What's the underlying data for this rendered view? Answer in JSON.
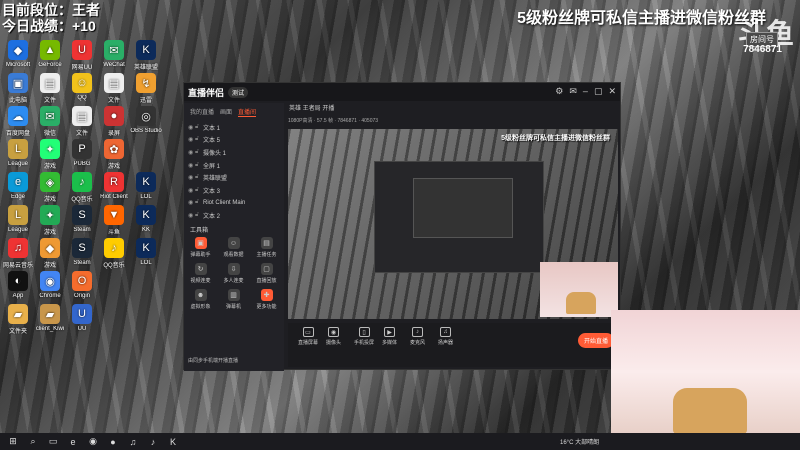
{
  "overlay": {
    "rank": "目前段位：王者",
    "today": "今日战绩：+10",
    "banner": "5级粉丝牌可私信主播进微信粉丝群",
    "room_label": "房间号",
    "room_id": "7846871"
  },
  "desktop_icons": [
    {
      "label": "Microsoft",
      "color": "#1d6fe0",
      "glyph": "◆"
    },
    {
      "label": "GeForce",
      "color": "#76b900",
      "glyph": "▲"
    },
    {
      "label": "网易UU",
      "color": "#e33",
      "glyph": "U"
    },
    {
      "label": "WeChat",
      "color": "#2aae67",
      "glyph": "✉"
    },
    {
      "label": "英雄联盟",
      "color": "#0c2a5a",
      "glyph": "K"
    },
    {
      "label": "此电脑",
      "color": "#3a7bd5",
      "glyph": "▣"
    },
    {
      "label": "文件",
      "color": "#eee",
      "glyph": "▤"
    },
    {
      "label": "QQ",
      "color": "#f2c21b",
      "glyph": "☺"
    },
    {
      "label": "文件",
      "color": "#eee",
      "glyph": "▤"
    },
    {
      "label": "迅雷",
      "color": "#f0a030",
      "glyph": "↯"
    },
    {
      "label": "百度网盘",
      "color": "#2d8cf0",
      "glyph": "☁"
    },
    {
      "label": "微信",
      "color": "#2aae67",
      "glyph": "✉"
    },
    {
      "label": "文件",
      "color": "#eee",
      "glyph": "▤"
    },
    {
      "label": "录屏",
      "color": "#c33",
      "glyph": "●"
    },
    {
      "label": "OBS Studio",
      "color": "#333",
      "glyph": "◎"
    },
    {
      "label": "League",
      "color": "#c8a040",
      "glyph": "L"
    },
    {
      "label": "游戏",
      "color": "#2f7",
      "glyph": "✦"
    },
    {
      "label": "PUBG",
      "color": "#333",
      "glyph": "P"
    },
    {
      "label": "游戏",
      "color": "#e63",
      "glyph": "✿"
    },
    {
      "label": "",
      "color": "transparent",
      "glyph": ""
    },
    {
      "label": "Edge",
      "color": "#0a9ad8",
      "glyph": "e"
    },
    {
      "label": "游戏",
      "color": "#3b3",
      "glyph": "◈"
    },
    {
      "label": "QQ音乐",
      "color": "#1bbf4b",
      "glyph": "♪"
    },
    {
      "label": "Riot Client",
      "color": "#e33",
      "glyph": "R"
    },
    {
      "label": "LOL",
      "color": "#0c2a5a",
      "glyph": "K"
    },
    {
      "label": "League",
      "color": "#c8a040",
      "glyph": "L"
    },
    {
      "label": "游戏",
      "color": "#2a5",
      "glyph": "✦"
    },
    {
      "label": "Steam",
      "color": "#1b2838",
      "glyph": "S"
    },
    {
      "label": "斗鱼",
      "color": "#f60",
      "glyph": "▼"
    },
    {
      "label": "KK",
      "color": "#0c2a5a",
      "glyph": "K"
    },
    {
      "label": "网易云音乐",
      "color": "#e33",
      "glyph": "♫"
    },
    {
      "label": "游戏",
      "color": "#e93",
      "glyph": "◆"
    },
    {
      "label": "Steam",
      "color": "#1b2838",
      "glyph": "S"
    },
    {
      "label": "QQ音乐",
      "color": "#fc0",
      "glyph": "♪"
    },
    {
      "label": "LOL",
      "color": "#0c2a5a",
      "glyph": "K"
    },
    {
      "label": "App",
      "color": "#111",
      "glyph": "◐"
    },
    {
      "label": "Chrome",
      "color": "#4285f4",
      "glyph": "◉"
    },
    {
      "label": "Origin",
      "color": "#f56c2d",
      "glyph": "O"
    },
    {
      "label": "",
      "color": "transparent",
      "glyph": ""
    },
    {
      "label": "",
      "color": "transparent",
      "glyph": ""
    },
    {
      "label": "文件夹",
      "color": "#e8b04a",
      "glyph": "▰"
    },
    {
      "label": "client_Kiwi",
      "color": "#c8964a",
      "glyph": "▰"
    },
    {
      "label": "UU",
      "color": "#36c",
      "glyph": "U"
    }
  ],
  "app": {
    "logo": "直播伴侣",
    "version": "测试",
    "stream_title": "英雄 王者局 开播",
    "tabs": [
      "我的直播",
      "画面",
      "直播间"
    ],
    "sources": [
      "文本 1",
      "文本 5",
      "摄像头 1",
      "全屏 1",
      "英雄联盟",
      "文本 3",
      "Riot Client Main",
      "文本 2"
    ],
    "tools_header": "工具箱",
    "tools": [
      {
        "label": "弹幕助手",
        "hot": true,
        "glyph": "▣"
      },
      {
        "label": "观看数据",
        "hot": false,
        "glyph": "☺"
      },
      {
        "label": "主播任务",
        "hot": false,
        "glyph": "▤"
      },
      {
        "label": "视频连麦",
        "hot": false,
        "glyph": "↻"
      },
      {
        "label": "多人连麦",
        "hot": false,
        "glyph": "⇩"
      },
      {
        "label": "直播回放",
        "hot": false,
        "glyph": "▢"
      },
      {
        "label": "虚拟形象",
        "hot": false,
        "glyph": "☻"
      },
      {
        "label": "弹幕机",
        "hot": false,
        "glyph": "▥"
      },
      {
        "label": "更多功能",
        "hot": true,
        "glyph": "✚"
      }
    ],
    "notice": "由同步手机端开播直播",
    "info": "1080P高清 · 57.5 帧  · 7846871 · 405073",
    "preview_banner": "5级粉丝牌可私信主播进微信粉丝群",
    "bottom": [
      {
        "label": "直播屏幕",
        "glyph": "▭"
      },
      {
        "label": "摄像头",
        "glyph": "◉"
      },
      {
        "label": "手机投屏",
        "glyph": "▯"
      },
      {
        "label": "多媒体",
        "glyph": "▶"
      },
      {
        "label": "麦克风",
        "glyph": "♪"
      },
      {
        "label": "扬声器",
        "glyph": "♫"
      }
    ],
    "live_button": "开始直播"
  },
  "taskbar": {
    "weather": "16°C 大部晴朗"
  }
}
